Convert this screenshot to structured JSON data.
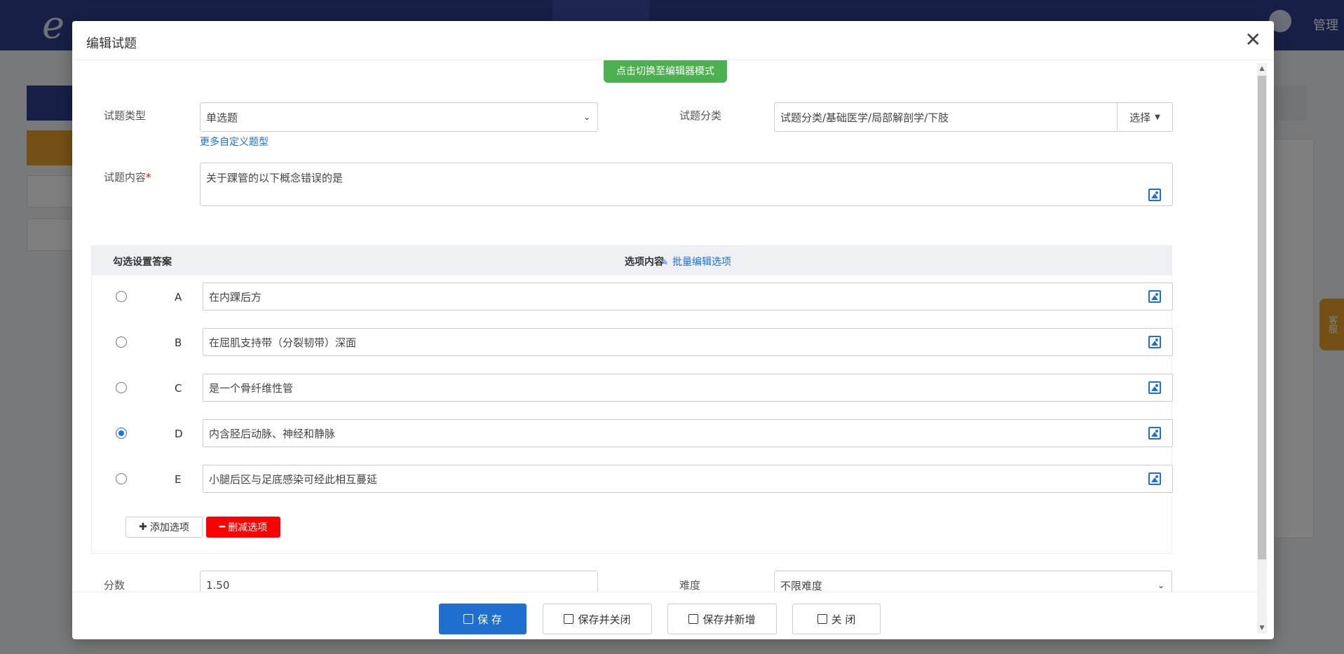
{
  "app": {
    "admin_label": "管理",
    "kefu_label": "客服"
  },
  "modal": {
    "title": "编辑试题",
    "close_glyph": "✕",
    "editor_toggle": "点击切换至编辑器模式"
  },
  "form": {
    "type_label": "试题类型",
    "type_value": "单选题",
    "custom_type_link": "更多自定义题型",
    "category_label": "试题分类",
    "category_value": "试题分类/基础医学/局部解剖学/下肢",
    "category_button": "选择",
    "content_label": "试题内容",
    "required_mark": "*",
    "content_value": "关于踝管的以下概念错误的是",
    "score_label": "分数",
    "score_value": "1.50",
    "difficulty_label": "难度",
    "difficulty_value": "不限难度"
  },
  "options": {
    "header_answer": "勾选设置答案",
    "header_content": "选项内容",
    "batch_edit": "批量编辑选项",
    "items": [
      {
        "letter": "A",
        "text": "在内踝后方",
        "checked": false
      },
      {
        "letter": "B",
        "text": "在屈肌支持带（分裂韧带）深面",
        "checked": false
      },
      {
        "letter": "C",
        "text": "是一个骨纤维性管",
        "checked": false
      },
      {
        "letter": "D",
        "text": "内含胫后动脉、神经和静脉",
        "checked": true
      },
      {
        "letter": "E",
        "text": "小腿后区与足底感染可经此相互蔓延",
        "checked": false
      }
    ],
    "add_button": "添加选项",
    "delete_button": "删减选项"
  },
  "footer": {
    "save": "保 存",
    "save_close": "保存并关闭",
    "save_new": "保存并新增",
    "close": "关 闭"
  },
  "colors": {
    "primary": "#1e6fd0",
    "toggle_green": "#4caf50",
    "danger": "#ff0000",
    "topbar": "#2f3f8f"
  }
}
